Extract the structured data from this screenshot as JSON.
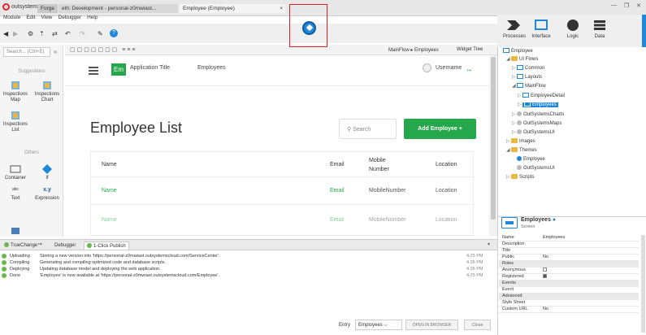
{
  "window": {
    "app_name": "outsystems",
    "tabs": [
      "Forge",
      "eth: Development - personal-z0mwiast...",
      "Employee (Employee)"
    ],
    "close_tab": "×"
  },
  "menu": [
    "Module",
    "Edit",
    "View",
    "Debugger",
    "Help"
  ],
  "rightbar": {
    "buttons": [
      "Processes",
      "Interface",
      "Logic",
      "Data"
    ]
  },
  "canvas_toolbar": {
    "flow": "MainFlow ▸ Employees",
    "widget_tree": "Widget Tree"
  },
  "left_panel": {
    "search_placeholder": "Search... (Ctrl+E)",
    "sections": [
      "Suggestions",
      "Others"
    ],
    "widgets": [
      "Inspections Map",
      "Inspections Chart",
      "Inspections List",
      "Container",
      "If",
      "Text",
      "Expression"
    ],
    "expr_label": "x.y",
    "text_label": "abc"
  },
  "app": {
    "logo": "Em",
    "title": "Application Title",
    "nav": "Employees",
    "username": "Username",
    "page_title": "Employee List",
    "search_placeholder": "Search",
    "add_button": "Add Employee  +",
    "table": {
      "headers": [
        "Name",
        "Email",
        "Mobile Number",
        "Location"
      ],
      "rows": [
        [
          "Name",
          "Email",
          "MobileNumber",
          "Location"
        ],
        [
          "Name",
          "Email",
          "MobileNumber",
          "Location"
        ]
      ]
    }
  },
  "bottom_panel": {
    "tabs": [
      "TrueChange™",
      "Debugger",
      "1-Click Publish"
    ],
    "log": [
      {
        "status": "Uploading",
        "msg": "Storing a new version into 'https://personal-z0mwiast.outsystemscloud.com/ServiceCenter'.",
        "time": "4:25 PM"
      },
      {
        "status": "Compiling",
        "msg": "Generating and compiling optimized code and database scripts.",
        "time": "4:26 PM"
      },
      {
        "status": "Deploying",
        "msg": "Updating database model and deploying the web application.",
        "time": "4:26 PM"
      },
      {
        "status": "Done",
        "msg": "'Employee' is now available at 'https://personal-z0mwiast.outsystemscloud.com/Employee'.",
        "time": "4:25 PM"
      }
    ],
    "entry_label": "Entry",
    "entry_value": "Employees",
    "open_browser": "OPEN IN BROWSER",
    "close": "Close"
  },
  "tree": {
    "root": "Employee",
    "items": [
      "UI Flows",
      "Common",
      "Layouts",
      "MainFlow",
      "EmployeeDetail",
      "Employees",
      "OutSystemsCharts",
      "OutSystemsMaps",
      "OutSystemsUI",
      "Images",
      "Themes",
      "Employee",
      "OutSystemsUI",
      "Scripts"
    ]
  },
  "properties": {
    "title": "Employees",
    "subtitle": "Screen",
    "rows": [
      {
        "k": "Name",
        "v": "Employees"
      },
      {
        "k": "Description",
        "v": ""
      },
      {
        "k": "Title",
        "v": ""
      },
      {
        "k": "Public",
        "v": "No"
      },
      {
        "k": "Roles",
        "v": ""
      },
      {
        "k": "Anonymous",
        "v": ""
      },
      {
        "k": "Registered",
        "v": ""
      },
      {
        "k": "Events",
        "v": ""
      },
      {
        "k": "Event",
        "v": ""
      },
      {
        "k": "Advanced",
        "v": ""
      },
      {
        "k": "Style Sheet",
        "v": ""
      },
      {
        "k": "Custom URL",
        "v": "No"
      }
    ]
  }
}
